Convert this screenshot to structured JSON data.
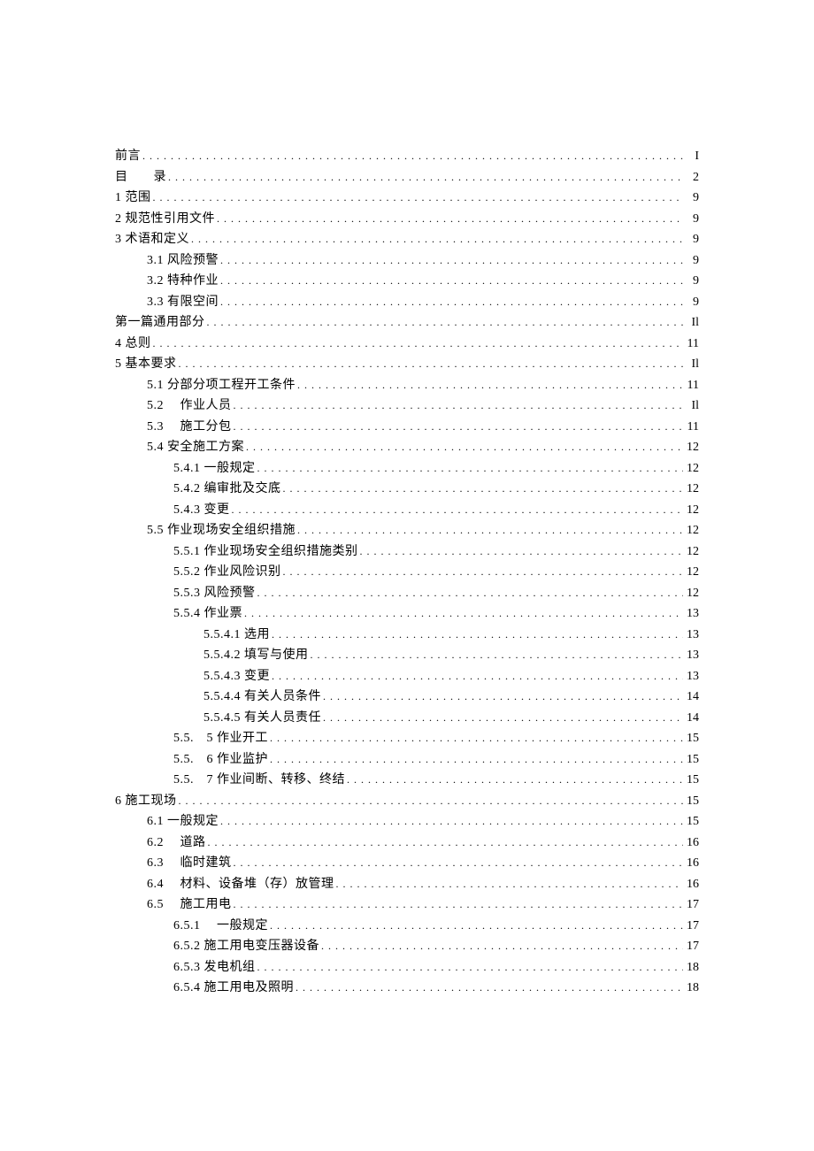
{
  "toc": [
    {
      "label": "前言",
      "page": "I",
      "indent": 0
    },
    {
      "label": "目　　录",
      "page": "2",
      "indent": 0
    },
    {
      "label": "1 范围",
      "page": "9",
      "indent": 0
    },
    {
      "label": "2 规范性引用文件",
      "page": "9",
      "indent": 0
    },
    {
      "label": "3 术语和定义",
      "page": "9",
      "indent": 0
    },
    {
      "label": "3.1 风险预警",
      "page": "9",
      "indent": 1
    },
    {
      "label": "3.2 特种作业",
      "page": "9",
      "indent": 1
    },
    {
      "label": "3.3 有限空间",
      "page": "9",
      "indent": 1
    },
    {
      "label": "第一篇通用部分",
      "page": "Il",
      "indent": 0
    },
    {
      "label": "4 总则",
      "page": "11",
      "indent": 0
    },
    {
      "label": "5 基本要求",
      "page": "Il",
      "indent": 0
    },
    {
      "label": "5.1 分部分项工程开工条件",
      "page": "11",
      "indent": 1
    },
    {
      "label": "5.2　 作业人员",
      "page": "Il",
      "indent": 1
    },
    {
      "label": "5.3　 施工分包",
      "page": "11",
      "indent": 1
    },
    {
      "label": "5.4 安全施工方案",
      "page": "12",
      "indent": 1
    },
    {
      "label": "5.4.1 一般规定",
      "page": "12",
      "indent": 2
    },
    {
      "label": "5.4.2 编审批及交底",
      "page": "12",
      "indent": 2
    },
    {
      "label": "5.4.3 变更",
      "page": "12",
      "indent": 2
    },
    {
      "label": "5.5 作业现场安全组织措施",
      "page": "12",
      "indent": 1
    },
    {
      "label": "5.5.1 作业现场安全组织措施类别",
      "page": "12",
      "indent": 2
    },
    {
      "label": "5.5.2 作业风险识别",
      "page": "12",
      "indent": 2
    },
    {
      "label": "5.5.3 风险预警",
      "page": "12",
      "indent": 2
    },
    {
      "label": "5.5.4 作业票",
      "page": "13",
      "indent": 2
    },
    {
      "label": "5.5.4.1 选用",
      "page": "13",
      "indent": 3
    },
    {
      "label": "5.5.4.2 填写与使用",
      "page": "13",
      "indent": 3
    },
    {
      "label": "5.5.4.3 变更",
      "page": "13",
      "indent": 3
    },
    {
      "label": "5.5.4.4 有关人员条件",
      "page": "14",
      "indent": 3
    },
    {
      "label": "5.5.4.5 有关人员责任",
      "page": "14",
      "indent": 3
    },
    {
      "label": "5.5.　5 作业开工",
      "page": "15",
      "indent": 2
    },
    {
      "label": "5.5.　6 作业监护",
      "page": "15",
      "indent": 2
    },
    {
      "label": "5.5.　7 作业间断、转移、终结",
      "page": "15",
      "indent": 2
    },
    {
      "label": "6 施工现场",
      "page": "15",
      "indent": 0
    },
    {
      "label": "6.1 一般规定",
      "page": "15",
      "indent": 1
    },
    {
      "label": "6.2　 道路",
      "page": "16",
      "indent": 1
    },
    {
      "label": "6.3　 临时建筑",
      "page": "16",
      "indent": 1
    },
    {
      "label": "6.4　 材料、设备堆（存）放管理",
      "page": "16",
      "indent": 1
    },
    {
      "label": "6.5　 施工用电",
      "page": "17",
      "indent": 1
    },
    {
      "label": "6.5.1 　一般规定",
      "page": "17",
      "indent": 2
    },
    {
      "label": "6.5.2 施工用电变压器设备",
      "page": "17",
      "indent": 2
    },
    {
      "label": "6.5.3 发电机组",
      "page": "18",
      "indent": 2
    },
    {
      "label": "6.5.4 施工用电及照明",
      "page": "18",
      "indent": 2
    }
  ]
}
